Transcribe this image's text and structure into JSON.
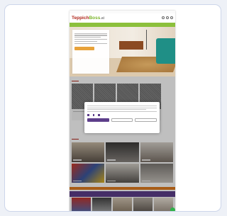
{
  "site": {
    "logo_part1": "Teppich",
    "logo_part2": "Boss",
    "logo_tld": ".at",
    "nav_items": [
      "",
      "",
      "",
      "",
      "",
      "",
      ""
    ]
  },
  "hero": {
    "headline": "",
    "cta": ""
  },
  "cookie_modal": {
    "title": ""
  },
  "colors": {
    "brand_red": "#b0271b",
    "brand_green": "#8cc03c",
    "accent_orange": "#e07b1f",
    "accent_purple": "#5d3e8a"
  }
}
